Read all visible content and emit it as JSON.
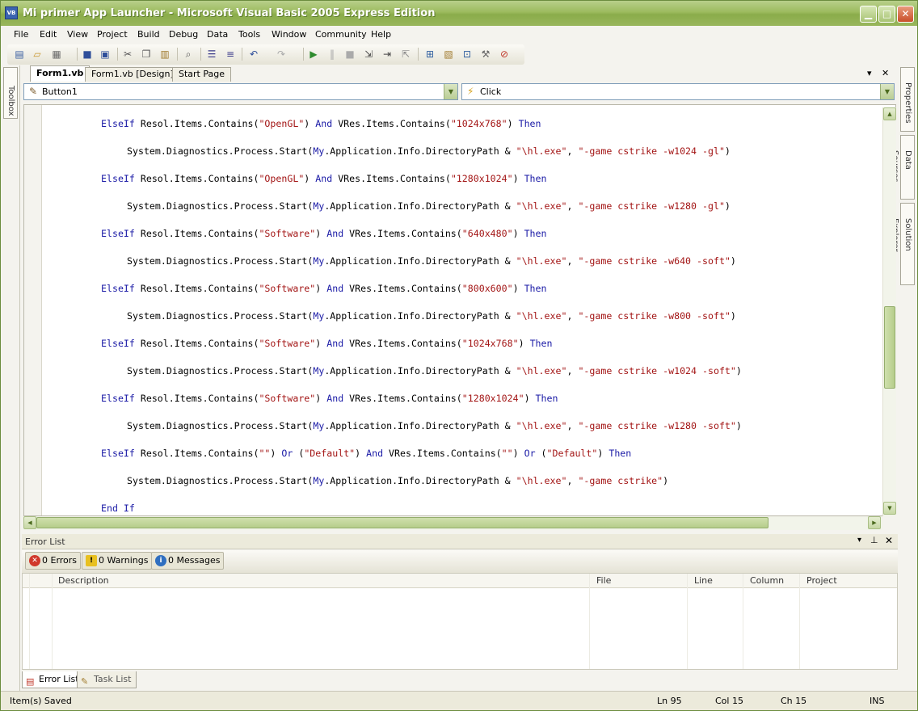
{
  "window": {
    "title": "Mi primer App Launcher - Microsoft Visual Basic 2005 Express Edition",
    "icon": "vb-icon",
    "min_glyph": "▁",
    "max_glyph": "□",
    "close_glyph": "✕"
  },
  "menu": [
    "File",
    "Edit",
    "View",
    "Project",
    "Build",
    "Debug",
    "Data",
    "Tools",
    "Window",
    "Community",
    "Help"
  ],
  "toolbar": {
    "icons": [
      "new-project-icon",
      "open-file-icon",
      "add-item-icon",
      "save-icon",
      "save-all-icon",
      "cut-icon",
      "copy-icon",
      "paste-icon",
      "find-icon",
      "comment-icon",
      "uncomment-icon",
      "undo-icon",
      "redo-icon",
      "start-debug-icon",
      "break-all-icon",
      "stop-debug-icon",
      "step-into-icon",
      "step-over-icon",
      "step-out-icon",
      "solution-explorer-icon",
      "properties-icon",
      "object-browser-icon",
      "toolbox-icon",
      "error-list-icon"
    ]
  },
  "side_panels": {
    "toolbox": "Toolbox",
    "properties": "Properties",
    "data_sources": "Data Sources",
    "solution_explorer": "Solution Explorer"
  },
  "doc_tabs": [
    {
      "label": "Form1.vb",
      "active": true
    },
    {
      "label": "Form1.vb [Design]",
      "active": false
    },
    {
      "label": "Start Page",
      "active": false
    }
  ],
  "tab_controls": {
    "dropdown": "▾",
    "close": "✕"
  },
  "combos": {
    "object": "Button1",
    "event": "Click"
  },
  "code": [
    {
      "indent": 1,
      "parts": [
        [
          "kw",
          "ElseIf"
        ],
        [
          "t",
          " Resol.Items.Contains("
        ],
        [
          "str",
          "\"OpenGL\""
        ],
        [
          "t",
          ") "
        ],
        [
          "kw",
          "And"
        ],
        [
          "t",
          " VRes.Items.Contains("
        ],
        [
          "str",
          "\"1024x768\""
        ],
        [
          "t",
          ") "
        ],
        [
          "kw",
          "Then"
        ]
      ]
    },
    {
      "indent": 2,
      "parts": [
        [
          "t",
          "System.Diagnostics.Process.Start("
        ],
        [
          "kw",
          "My"
        ],
        [
          "t",
          ".Application.Info.DirectoryPath & "
        ],
        [
          "str",
          "\"\\hl.exe\""
        ],
        [
          "t",
          ", "
        ],
        [
          "str",
          "\"-game cstrike -w1024 -gl\""
        ],
        [
          "t",
          ")"
        ]
      ]
    },
    {
      "indent": 1,
      "parts": [
        [
          "kw",
          "ElseIf"
        ],
        [
          "t",
          " Resol.Items.Contains("
        ],
        [
          "str",
          "\"OpenGL\""
        ],
        [
          "t",
          ") "
        ],
        [
          "kw",
          "And"
        ],
        [
          "t",
          " VRes.Items.Contains("
        ],
        [
          "str",
          "\"1280x1024\""
        ],
        [
          "t",
          ") "
        ],
        [
          "kw",
          "Then"
        ]
      ]
    },
    {
      "indent": 2,
      "parts": [
        [
          "t",
          "System.Diagnostics.Process.Start("
        ],
        [
          "kw",
          "My"
        ],
        [
          "t",
          ".Application.Info.DirectoryPath & "
        ],
        [
          "str",
          "\"\\hl.exe\""
        ],
        [
          "t",
          ", "
        ],
        [
          "str",
          "\"-game cstrike -w1280 -gl\""
        ],
        [
          "t",
          ")"
        ]
      ]
    },
    {
      "indent": 1,
      "parts": [
        [
          "kw",
          "ElseIf"
        ],
        [
          "t",
          " Resol.Items.Contains("
        ],
        [
          "str",
          "\"Software\""
        ],
        [
          "t",
          ") "
        ],
        [
          "kw",
          "And"
        ],
        [
          "t",
          " VRes.Items.Contains("
        ],
        [
          "str",
          "\"640x480\""
        ],
        [
          "t",
          ") "
        ],
        [
          "kw",
          "Then"
        ]
      ]
    },
    {
      "indent": 2,
      "parts": [
        [
          "t",
          "System.Diagnostics.Process.Start("
        ],
        [
          "kw",
          "My"
        ],
        [
          "t",
          ".Application.Info.DirectoryPath & "
        ],
        [
          "str",
          "\"\\hl.exe\""
        ],
        [
          "t",
          ", "
        ],
        [
          "str",
          "\"-game cstrike -w640 -soft\""
        ],
        [
          "t",
          ")"
        ]
      ]
    },
    {
      "indent": 1,
      "parts": [
        [
          "kw",
          "ElseIf"
        ],
        [
          "t",
          " Resol.Items.Contains("
        ],
        [
          "str",
          "\"Software\""
        ],
        [
          "t",
          ") "
        ],
        [
          "kw",
          "And"
        ],
        [
          "t",
          " VRes.Items.Contains("
        ],
        [
          "str",
          "\"800x600\""
        ],
        [
          "t",
          ") "
        ],
        [
          "kw",
          "Then"
        ]
      ]
    },
    {
      "indent": 2,
      "parts": [
        [
          "t",
          "System.Diagnostics.Process.Start("
        ],
        [
          "kw",
          "My"
        ],
        [
          "t",
          ".Application.Info.DirectoryPath & "
        ],
        [
          "str",
          "\"\\hl.exe\""
        ],
        [
          "t",
          ", "
        ],
        [
          "str",
          "\"-game cstrike -w800 -soft\""
        ],
        [
          "t",
          ")"
        ]
      ]
    },
    {
      "indent": 1,
      "parts": [
        [
          "kw",
          "ElseIf"
        ],
        [
          "t",
          " Resol.Items.Contains("
        ],
        [
          "str",
          "\"Software\""
        ],
        [
          "t",
          ") "
        ],
        [
          "kw",
          "And"
        ],
        [
          "t",
          " VRes.Items.Contains("
        ],
        [
          "str",
          "\"1024x768\""
        ],
        [
          "t",
          ") "
        ],
        [
          "kw",
          "Then"
        ]
      ]
    },
    {
      "indent": 2,
      "parts": [
        [
          "t",
          "System.Diagnostics.Process.Start("
        ],
        [
          "kw",
          "My"
        ],
        [
          "t",
          ".Application.Info.DirectoryPath & "
        ],
        [
          "str",
          "\"\\hl.exe\""
        ],
        [
          "t",
          ", "
        ],
        [
          "str",
          "\"-game cstrike -w1024 -soft\""
        ],
        [
          "t",
          ")"
        ]
      ]
    },
    {
      "indent": 1,
      "parts": [
        [
          "kw",
          "ElseIf"
        ],
        [
          "t",
          " Resol.Items.Contains("
        ],
        [
          "str",
          "\"Software\""
        ],
        [
          "t",
          ") "
        ],
        [
          "kw",
          "And"
        ],
        [
          "t",
          " VRes.Items.Contains("
        ],
        [
          "str",
          "\"1280x1024\""
        ],
        [
          "t",
          ") "
        ],
        [
          "kw",
          "Then"
        ]
      ]
    },
    {
      "indent": 2,
      "parts": [
        [
          "t",
          "System.Diagnostics.Process.Start("
        ],
        [
          "kw",
          "My"
        ],
        [
          "t",
          ".Application.Info.DirectoryPath & "
        ],
        [
          "str",
          "\"\\hl.exe\""
        ],
        [
          "t",
          ", "
        ],
        [
          "str",
          "\"-game cstrike -w1280 -soft\""
        ],
        [
          "t",
          ")"
        ]
      ]
    },
    {
      "indent": 1,
      "parts": [
        [
          "kw",
          "ElseIf"
        ],
        [
          "t",
          " Resol.Items.Contains("
        ],
        [
          "str",
          "\"\""
        ],
        [
          "t",
          ") "
        ],
        [
          "kw",
          "Or"
        ],
        [
          "t",
          " ("
        ],
        [
          "str",
          "\"Default\""
        ],
        [
          "t",
          ") "
        ],
        [
          "kw",
          "And"
        ],
        [
          "t",
          " VRes.Items.Contains("
        ],
        [
          "str",
          "\"\""
        ],
        [
          "t",
          ") "
        ],
        [
          "kw",
          "Or"
        ],
        [
          "t",
          " ("
        ],
        [
          "str",
          "\"Default\""
        ],
        [
          "t",
          ") "
        ],
        [
          "kw",
          "Then"
        ]
      ]
    },
    {
      "indent": 2,
      "parts": [
        [
          "t",
          "System.Diagnostics.Process.Start("
        ],
        [
          "kw",
          "My"
        ],
        [
          "t",
          ".Application.Info.DirectoryPath & "
        ],
        [
          "str",
          "\"\\hl.exe\""
        ],
        [
          "t",
          ", "
        ],
        [
          "str",
          "\"-game cstrike\""
        ],
        [
          "t",
          ")"
        ]
      ]
    },
    {
      "indent": 1,
      "parts": [
        [
          "kw",
          "End If"
        ]
      ]
    }
  ],
  "colors": {
    "keyword": "#1a1aa6",
    "string": "#a31515",
    "titlebar": "#9cbb5e"
  },
  "error_list": {
    "title": "Error List",
    "errors": "0 Errors",
    "warnings": "0 Warnings",
    "messages": "0 Messages",
    "columns": [
      "Description",
      "File",
      "Line",
      "Column",
      "Project"
    ]
  },
  "bottom_tabs": [
    {
      "label": "Error List",
      "active": true
    },
    {
      "label": "Task List",
      "active": false
    }
  ],
  "status": {
    "message": "Item(s) Saved",
    "ln": "Ln 95",
    "col": "Col 15",
    "ch": "Ch 15",
    "ins": "INS"
  }
}
